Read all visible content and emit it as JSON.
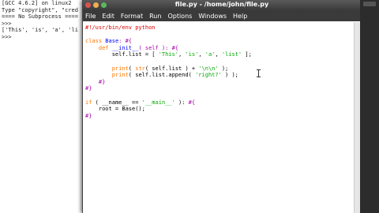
{
  "shell": {
    "lines": [
      "[GCC 4.6.2] on linux2",
      "Type \"copyright\", \"cred",
      "==== No Subprocess ====",
      ">>> ",
      "['This', 'is', 'a', 'li",
      "",
      ">>> "
    ]
  },
  "editor": {
    "title": "file.py - /home/john/file.py",
    "menu": [
      "File",
      "Edit",
      "Format",
      "Run",
      "Options",
      "Windows",
      "Help"
    ]
  },
  "code_lines": [
    [
      {
        "t": "#!/usr/bin/env python",
        "c": "com"
      }
    ],
    [],
    [
      {
        "t": "class ",
        "c": "kw"
      },
      {
        "t": "Base",
        "c": "def"
      },
      {
        "t": ": #{",
        "c": "br"
      }
    ],
    [
      {
        "t": "    "
      },
      {
        "t": "def ",
        "c": "kw"
      },
      {
        "t": "__init__",
        "c": "def"
      },
      {
        "t": "( self ): #{",
        "c": "br"
      }
    ],
    [
      {
        "t": "        self.list = [ "
      },
      {
        "t": "'This'",
        "c": "str"
      },
      {
        "t": ", "
      },
      {
        "t": "'is'",
        "c": "str"
      },
      {
        "t": ", "
      },
      {
        "t": "'a'",
        "c": "str"
      },
      {
        "t": ", "
      },
      {
        "t": "'list'",
        "c": "str"
      },
      {
        "t": " ];"
      }
    ],
    [],
    [
      {
        "t": "        "
      },
      {
        "t": "print",
        "c": "kw"
      },
      {
        "t": "( "
      },
      {
        "t": "str",
        "c": "kw"
      },
      {
        "t": "( self.list ) + "
      },
      {
        "t": "'\\n\\n'",
        "c": "str"
      },
      {
        "t": " );"
      }
    ],
    [
      {
        "t": "        "
      },
      {
        "t": "print",
        "c": "kw"
      },
      {
        "t": "( self.list.append( "
      },
      {
        "t": "'right?'",
        "c": "str"
      },
      {
        "t": " ) );"
      }
    ],
    [
      {
        "t": "    #}",
        "c": "br"
      }
    ],
    [
      {
        "t": "#}",
        "c": "br"
      }
    ],
    [],
    [
      {
        "t": "if",
        "c": "kw"
      },
      {
        "t": " ( __name__ == "
      },
      {
        "t": "'__main__'",
        "c": "str"
      },
      {
        "t": " ): "
      },
      {
        "t": "#{",
        "c": "br"
      }
    ],
    [
      {
        "t": "    root = Base();"
      }
    ],
    [
      {
        "t": "#}",
        "c": "br"
      }
    ]
  ]
}
